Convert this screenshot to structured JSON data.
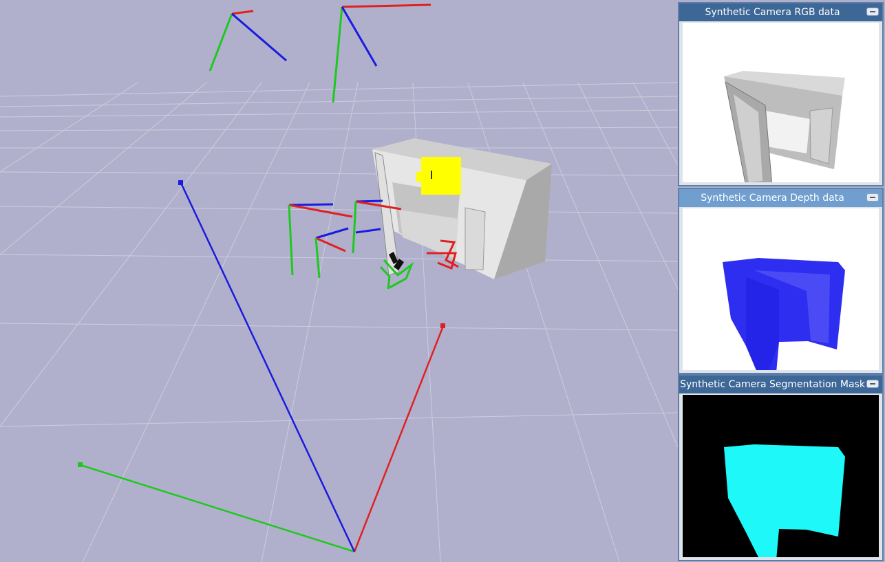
{
  "scene": {
    "background_color": "#b0b0cc",
    "grid_color": "#d6d6e4",
    "axis_colors": {
      "x": "#e02020",
      "y": "#1ec81e",
      "z": "#1a1ae0"
    }
  },
  "panels": [
    {
      "title": "Synthetic Camera RGB data",
      "kind": "rgb",
      "active": false
    },
    {
      "title": "Synthetic Camera Depth data",
      "kind": "depth",
      "active": true
    },
    {
      "title": "Synthetic Camera Segmentation Mask",
      "kind": "segmentation",
      "active": false
    }
  ],
  "colors": {
    "depth_fill": "#3a3af2",
    "segmentation_fill": "#1ef8f8",
    "segmentation_bg": "#000000",
    "rgb_bg": "#ffffff",
    "gripper_marker": "#ffff00"
  }
}
